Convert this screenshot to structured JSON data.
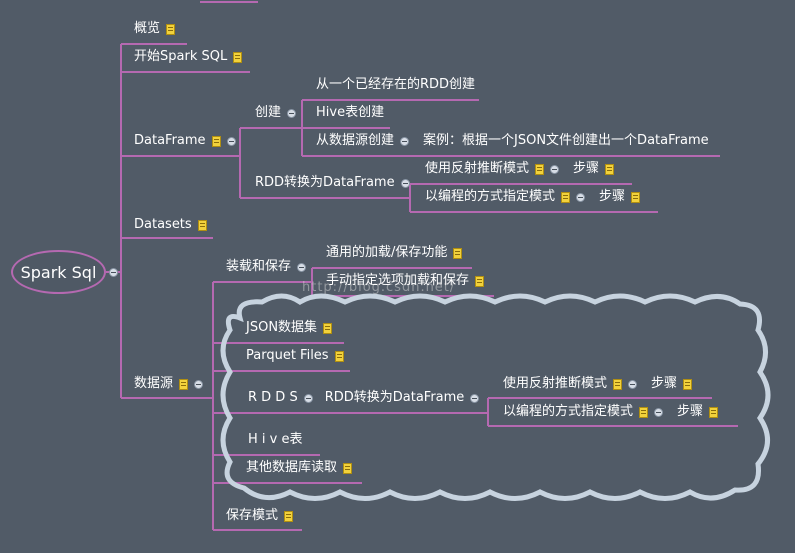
{
  "root": {
    "label": "Spark Sql"
  },
  "watermark": "http://blog.csdn.net/",
  "branches": {
    "overview": "概览",
    "start": "开始Spark SQL",
    "dataframe": {
      "label": "DataFrame",
      "create": {
        "label": "创建",
        "from_rdd": "从一个已经存在的RDD创建",
        "from_hive": "Hive表创建",
        "from_source": "从数据源创建",
        "example": "案例：根据一个JSON文件创建出一个DataFrame"
      },
      "rdd_convert": {
        "label": "RDD转换为DataFrame",
        "reflection": "使用反射推断模式",
        "programmatic": "以编程的方式指定模式",
        "steps": "步骤"
      }
    },
    "datasets": "Datasets",
    "sources": {
      "label": "数据源",
      "load_save": {
        "label": "装载和保存",
        "generic": "通用的加载/保存功能",
        "manual": "手动指定选项加载和保存"
      },
      "json": "JSON数据集",
      "parquet": "Parquet Files",
      "rdds": {
        "label": "R D D S",
        "convert": "RDD转换为DataFrame",
        "reflection": "使用反射推断模式",
        "programmatic": "以编程的方式指定模式",
        "steps": "步骤"
      },
      "hive": "H i v e表",
      "other_db": "其他数据库读取",
      "save_mode": "保存模式"
    }
  }
}
